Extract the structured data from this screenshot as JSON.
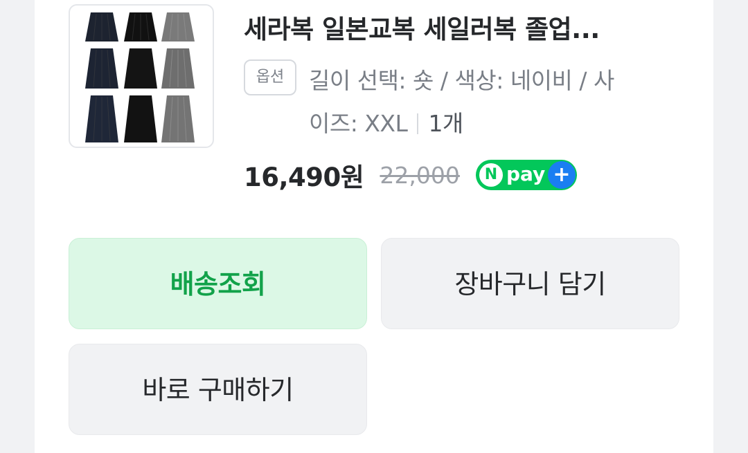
{
  "product": {
    "title": "세라복 일본교복 세일러복 졸업...",
    "option_badge": "옵션",
    "option_line1": "길이 선택: 숏 / 색상: 네이비 / 사",
    "option_line2": "이즈: XXL",
    "quantity": "1개",
    "price": "16,490원",
    "original_price": "22,000",
    "npay": {
      "n": "N",
      "pay": "pay",
      "plus": "+"
    },
    "thumbnail_icon": "skirt-grid-image"
  },
  "actions": {
    "track_label": "배송조회",
    "cart_label": "장바구니 담기",
    "buy_label": "바로 구매하기"
  },
  "colors": {
    "track_bg": "#dcf8e6",
    "track_text": "#12a24a",
    "npay_green": "#03c75a",
    "npay_blue": "#1a7ef2"
  }
}
